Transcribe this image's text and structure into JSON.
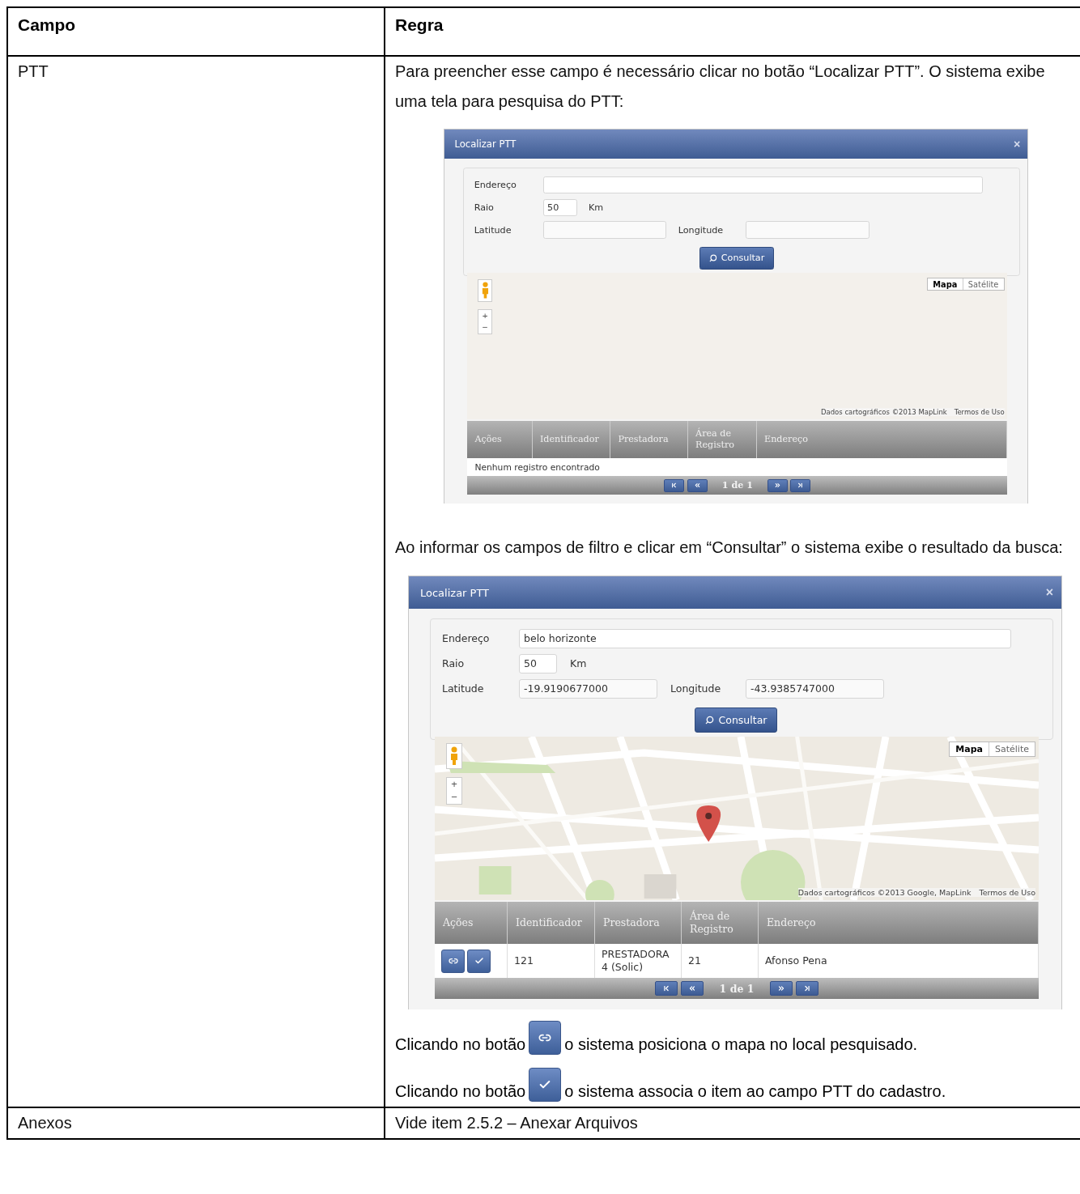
{
  "table": {
    "columns": [
      {
        "label": "Campo"
      },
      {
        "label": "Regra"
      }
    ],
    "rows": [
      {
        "field": "PTT",
        "rule": [
          {
            "kind": "paragraph",
            "text": "Para preencher esse campo é necessário clicar no botão “Localizar PTT”. O sistema exibe uma tela para pesquisa do PTT:"
          },
          {
            "kind": "dialog",
            "title": "Localizar PTT",
            "close": "×",
            "form": {
              "address": {
                "label": "Endereço"
              },
              "radius": {
                "label": "Raio",
                "value": "50",
                "unit": "Km"
              },
              "latitude": {
                "label": "Latitude"
              },
              "longitude": {
                "label": "Longitude"
              }
            },
            "search_button": "Consultar",
            "map": {
              "kind": "blank",
              "zoom_in": "+",
              "zoom_out": "−",
              "map_types": [
                {
                  "label": "Mapa",
                  "selected": true
                },
                {
                  "label": "Satélite",
                  "selected": false
                }
              ],
              "attribution": "Dados cartográficos ©2013 MapLink",
              "terms": "Termos de Uso"
            },
            "results": {
              "columns": [
                "Ações",
                "Identificador",
                "Prestadora",
                "Área de Registro",
                "Endereço"
              ],
              "empty_message": "Nenhum registro encontrado",
              "page_label": "1 de 1"
            }
          },
          {
            "kind": "paragraph",
            "text": "Ao informar os campos de filtro e clicar em “Consultar” o sistema exibe o resultado da busca:"
          },
          {
            "kind": "dialog",
            "title": "Localizar PTT",
            "close": "×",
            "form": {
              "address": {
                "label": "Endereço",
                "value": "belo horizonte"
              },
              "radius": {
                "label": "Raio",
                "value": "50",
                "unit": "Km"
              },
              "latitude": {
                "label": "Latitude",
                "value": "-19.9190677000"
              },
              "longitude": {
                "label": "Longitude",
                "value": "-43.9385747000"
              }
            },
            "search_button": "Consultar",
            "map": {
              "kind": "picture",
              "zoom_in": "+",
              "zoom_out": "−",
              "map_types": [
                {
                  "label": "Mapa",
                  "selected": true
                },
                {
                  "label": "Satélite",
                  "selected": false
                }
              ],
              "attribution": "Dados cartográficos ©2013 Google, MapLink",
              "terms": "Termos de Uso"
            },
            "results": {
              "columns": [
                "Ações",
                "Identificador",
                "Prestadora",
                "Área de Registro",
                "Endereço"
              ],
              "rows": [
                {
                  "cells": [
                    {
                      "kind": "actions",
                      "actions": [
                        {
                          "kind": "locate"
                        },
                        {
                          "kind": "associate"
                        }
                      ]
                    },
                    {
                      "kind": "text",
                      "text": "121"
                    },
                    {
                      "kind": "text",
                      "text": "PRESTADORA 4 (Solic)"
                    },
                    {
                      "kind": "text",
                      "text": "21"
                    },
                    {
                      "kind": "text",
                      "text": "Afonso Pena"
                    }
                  ]
                }
              ],
              "page_label": "1 de 1"
            }
          },
          {
            "kind": "locate_note",
            "before": "Clicando no botão",
            "after": "o sistema posiciona o mapa no local pesquisado."
          },
          {
            "kind": "associate_note",
            "before": "Clicando no botão",
            "after": "o sistema associa o item ao campo PTT do cadastro."
          }
        ]
      },
      {
        "field": "Anexos",
        "rule": [
          {
            "kind": "paragraph",
            "text": "Vide item 2.5.2 – Anexar Arquivos"
          }
        ]
      }
    ]
  }
}
